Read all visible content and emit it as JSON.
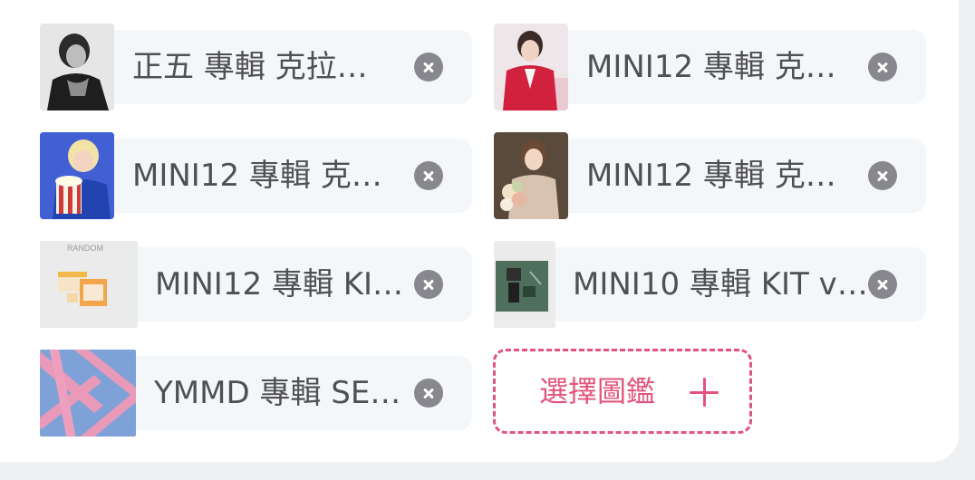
{
  "selected_items": [
    {
      "label": "正五 專輯 克拉…",
      "thumbnail": "photo-member-black-white",
      "remove_icon": "close-circle-icon"
    },
    {
      "label": "MINI12 專輯 克…",
      "thumbnail": "photo-member-red-suit",
      "remove_icon": "close-circle-icon"
    },
    {
      "label": "MINI12 專輯 克…",
      "thumbnail": "photo-member-blue-popcorn",
      "remove_icon": "close-circle-icon"
    },
    {
      "label": "MINI12 專輯 克…",
      "thumbnail": "photo-member-flowers",
      "remove_icon": "close-circle-icon"
    },
    {
      "label": "MINI12 專輯 KI…",
      "thumbnail": "album-kit-orange-boxes",
      "thumbnail_caption": "RANDOM",
      "remove_icon": "close-circle-icon"
    },
    {
      "label": "MINI10 專輯 KIT v…",
      "thumbnail": "album-kit-green-box",
      "remove_icon": "close-circle-icon"
    },
    {
      "label": "YMMD 專輯 SE…",
      "thumbnail": "album-cover-blue-pink-ribbons",
      "remove_icon": "close-circle-icon"
    }
  ],
  "add_button": {
    "label": "選擇圖鑑",
    "icon": "plus-icon"
  },
  "colors": {
    "accent": "#e2547d",
    "chip_background": "#f4f7f9",
    "text": "#4f4f55",
    "close_icon": "#87878d"
  }
}
